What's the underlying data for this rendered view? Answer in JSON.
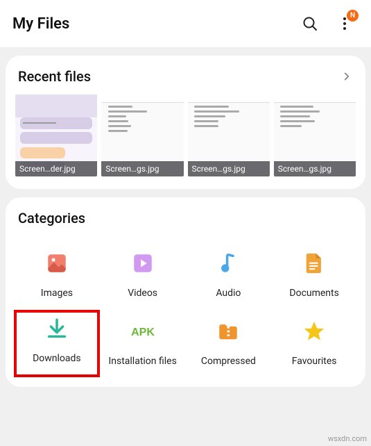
{
  "header": {
    "title": "My Files",
    "badge": "N"
  },
  "recent": {
    "title": "Recent files",
    "files": [
      {
        "name": "Screen…der.jpg"
      },
      {
        "name": "Screen…gs.jpg"
      },
      {
        "name": "Screen…gs.jpg"
      },
      {
        "name": "Screen…gs.jpg"
      }
    ]
  },
  "categories": {
    "title": "Categories",
    "items": [
      {
        "label": "Images"
      },
      {
        "label": "Videos"
      },
      {
        "label": "Audio"
      },
      {
        "label": "Documents"
      },
      {
        "label": "Downloads"
      },
      {
        "label": "Installation files"
      },
      {
        "label": "Compressed"
      },
      {
        "label": "Favourites"
      }
    ]
  },
  "watermark": "wsxdn.com"
}
